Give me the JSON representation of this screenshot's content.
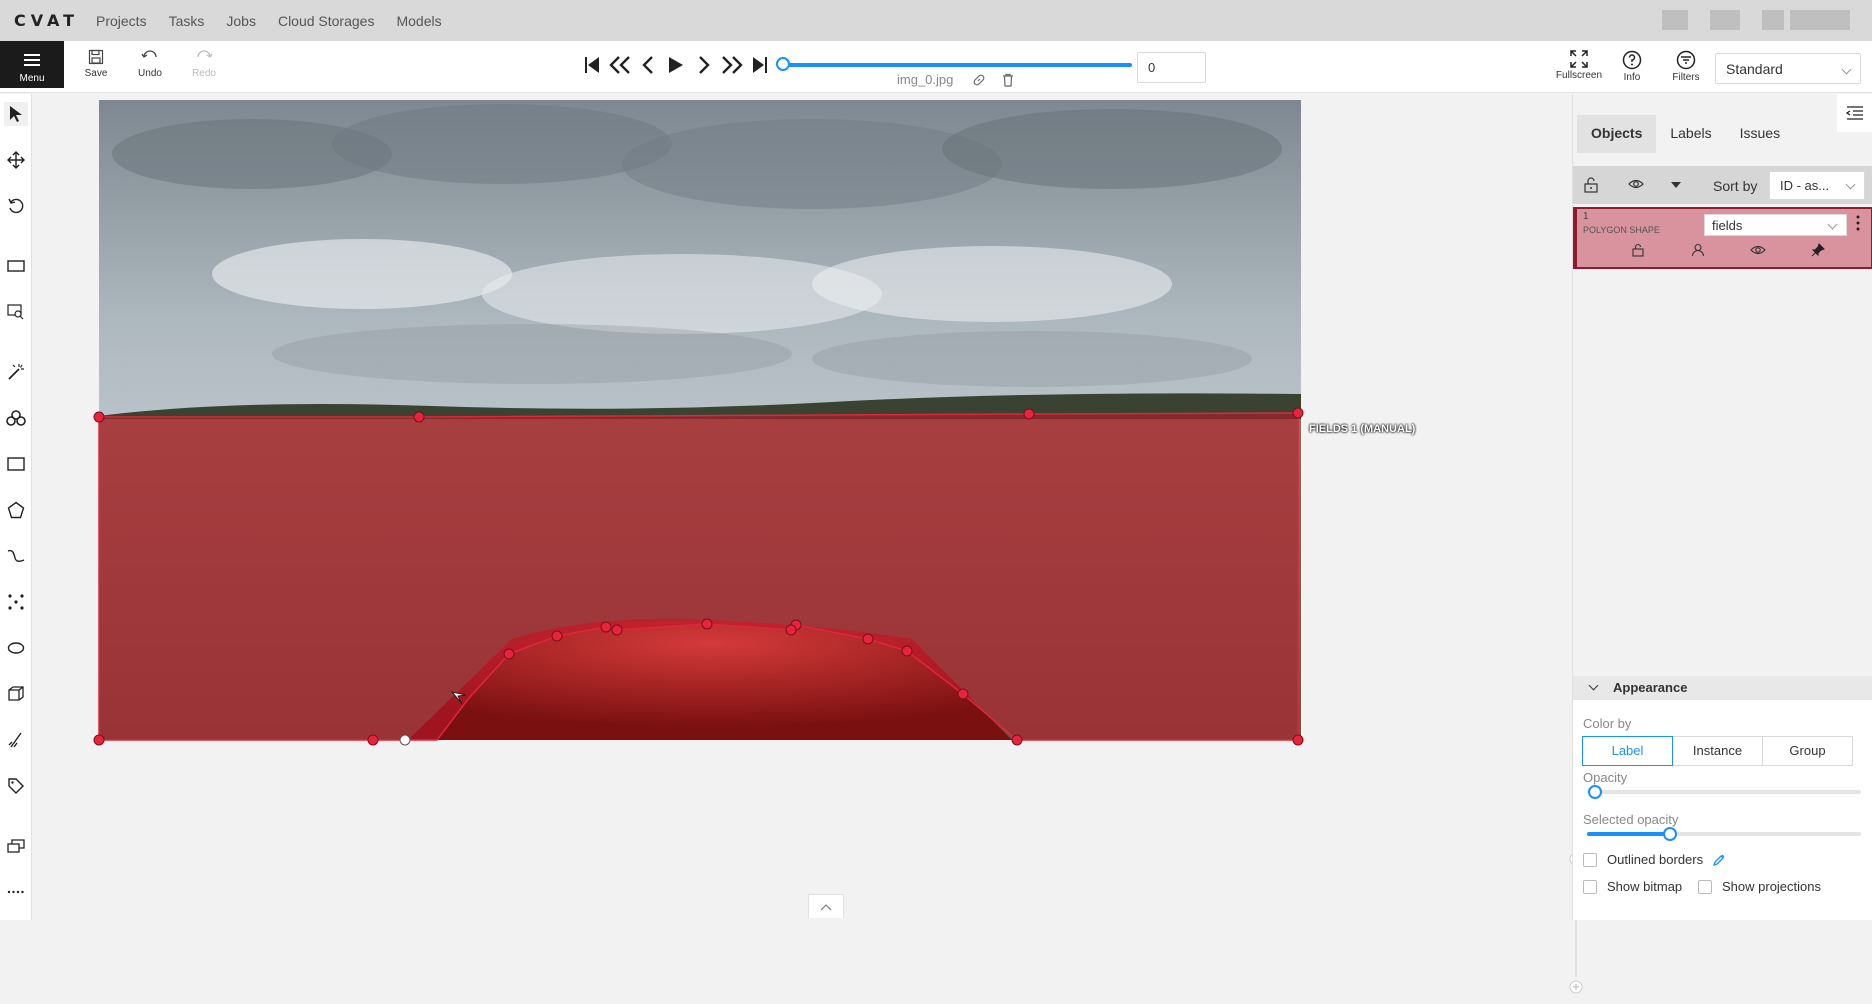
{
  "app": {
    "logo": "CVAT"
  },
  "nav": {
    "items": [
      "Projects",
      "Tasks",
      "Jobs",
      "Cloud Storages",
      "Models"
    ]
  },
  "toolbar": {
    "menu_label": "Menu",
    "save_label": "Save",
    "undo_label": "Undo",
    "redo_label": "Redo",
    "frame_number": "0",
    "filename": "img_0.jpg",
    "fullscreen_label": "Fullscreen",
    "info_label": "Info",
    "filters_label": "Filters",
    "workspace": "Standard"
  },
  "canvas": {
    "shape_label": "FIELDS 1 (MANUAL)",
    "shape_color": "#c0172c"
  },
  "sidebar": {
    "tabs": [
      "Objects",
      "Labels",
      "Issues"
    ],
    "sort_label": "Sort by",
    "sort_value": "ID - as...",
    "objects": [
      {
        "id": "1",
        "type": "POLYGON SHAPE",
        "label": "fields"
      }
    ],
    "appearance": {
      "title": "Appearance",
      "color_by_label": "Color by",
      "color_by_options": [
        "Label",
        "Instance",
        "Group"
      ],
      "color_by_selected": "Label",
      "opacity_label": "Opacity",
      "opacity": 0,
      "selected_opacity_label": "Selected opacity",
      "selected_opacity": 0.3,
      "outlined_borders_label": "Outlined borders",
      "show_bitmap_label": "Show bitmap",
      "show_projections_label": "Show projections"
    }
  },
  "colors": {
    "accent": "#1890ff",
    "menu_bg": "#1b1b1b"
  }
}
